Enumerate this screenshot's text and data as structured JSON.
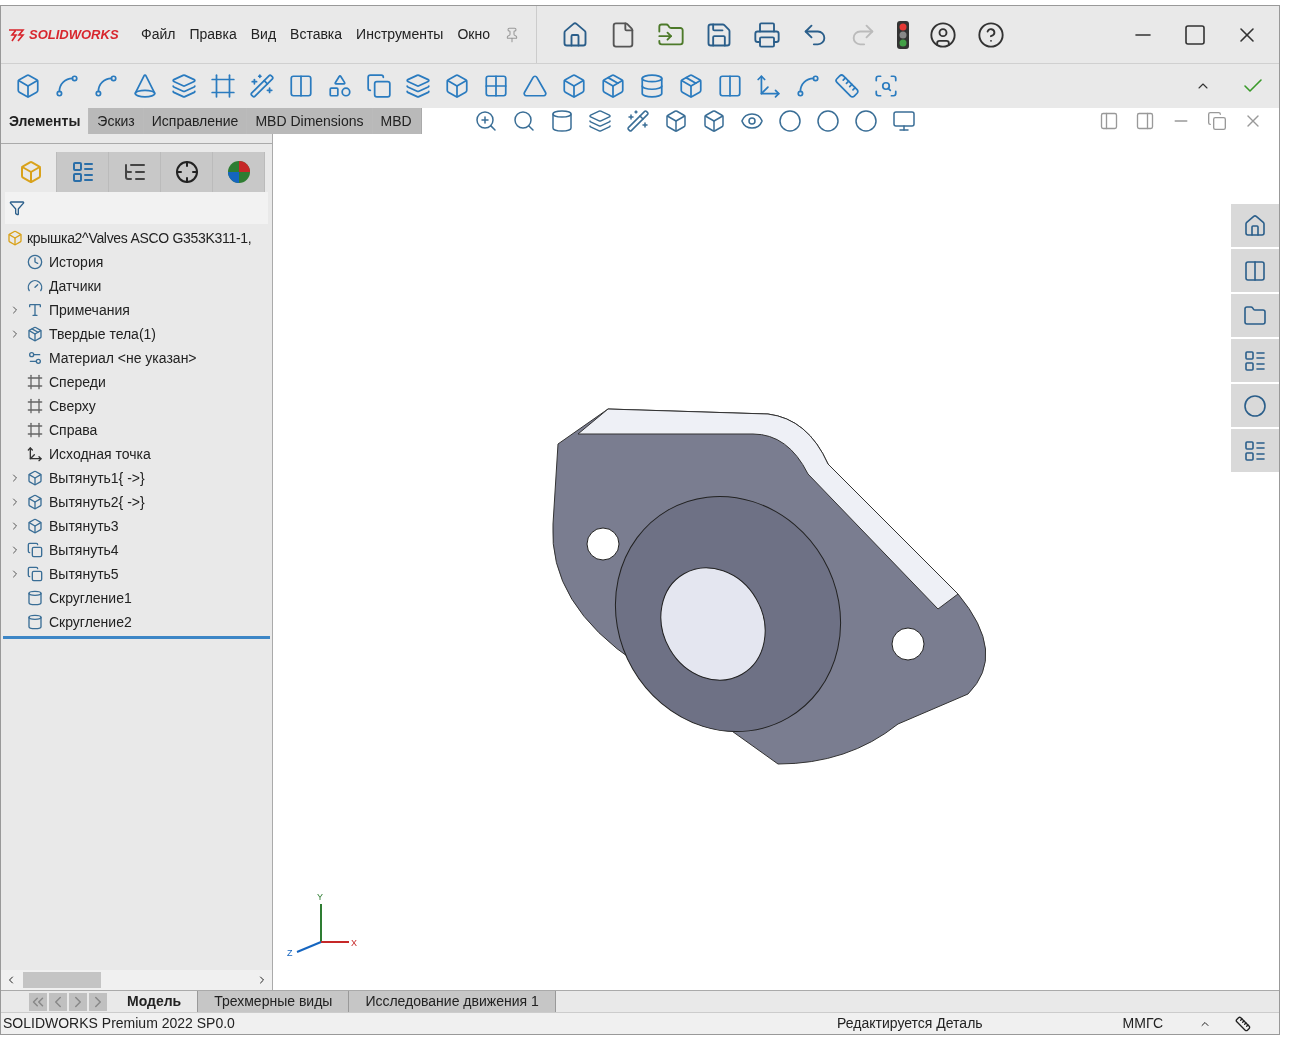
{
  "app": {
    "logo": "SOLIDWORKS"
  },
  "menu": [
    "Файл",
    "Правка",
    "Вид",
    "Вставка",
    "Инструменты",
    "Окно"
  ],
  "command_tabs": [
    {
      "label": "Элементы",
      "selected": true
    },
    {
      "label": "Эскиз",
      "selected": false
    },
    {
      "label": "Исправление",
      "selected": false
    },
    {
      "label": "MBD Dimensions",
      "selected": false
    },
    {
      "label": "MBD",
      "selected": false
    }
  ],
  "feature_manager": {
    "panel_tabs": [
      {
        "kind": "features",
        "selected": true
      },
      {
        "kind": "properties",
        "selected": false
      },
      {
        "kind": "config",
        "selected": false
      },
      {
        "kind": "dimxpert",
        "selected": false
      },
      {
        "kind": "display",
        "selected": false
      }
    ],
    "root": "крышка2^Valves ASCO G353K311-1,",
    "items": [
      {
        "label": "История",
        "kind": "history",
        "expandable": false
      },
      {
        "label": "Датчики",
        "kind": "sensors",
        "expandable": false
      },
      {
        "label": "Примечания",
        "kind": "annotations",
        "expandable": true
      },
      {
        "label": "Твердые тела(1)",
        "kind": "bodies",
        "expandable": true
      },
      {
        "label": "Материал <не указан>",
        "kind": "material",
        "expandable": false
      },
      {
        "label": "Спереди",
        "kind": "plane",
        "expandable": false
      },
      {
        "label": "Сверху",
        "kind": "plane",
        "expandable": false
      },
      {
        "label": "Справа",
        "kind": "plane",
        "expandable": false
      },
      {
        "label": "Исходная точка",
        "kind": "origin",
        "expandable": false
      },
      {
        "label": "Вытянуть1{ ->}",
        "kind": "extrude",
        "expandable": true
      },
      {
        "label": "Вытянуть2{ ->}",
        "kind": "extrude",
        "expandable": true
      },
      {
        "label": "Вытянуть3",
        "kind": "extrude",
        "expandable": true
      },
      {
        "label": "Вытянуть4",
        "kind": "cut",
        "expandable": true
      },
      {
        "label": "Вытянуть5",
        "kind": "cut",
        "expandable": true
      },
      {
        "label": "Скругление1",
        "kind": "fillet",
        "expandable": false
      },
      {
        "label": "Скругление2",
        "kind": "fillet",
        "expandable": false
      }
    ]
  },
  "triad": {
    "y": "Y",
    "x": "X",
    "z": "Z"
  },
  "bottom_tabs": [
    {
      "label": "Модель",
      "selected": true
    },
    {
      "label": "Трехмерные виды",
      "selected": false
    },
    {
      "label": "Исследование движения 1",
      "selected": false
    }
  ],
  "status_bar": {
    "product": "SOLIDWORKS Premium 2022 SP0.0",
    "mode": "Редактируется Деталь",
    "units": "ММГС"
  }
}
